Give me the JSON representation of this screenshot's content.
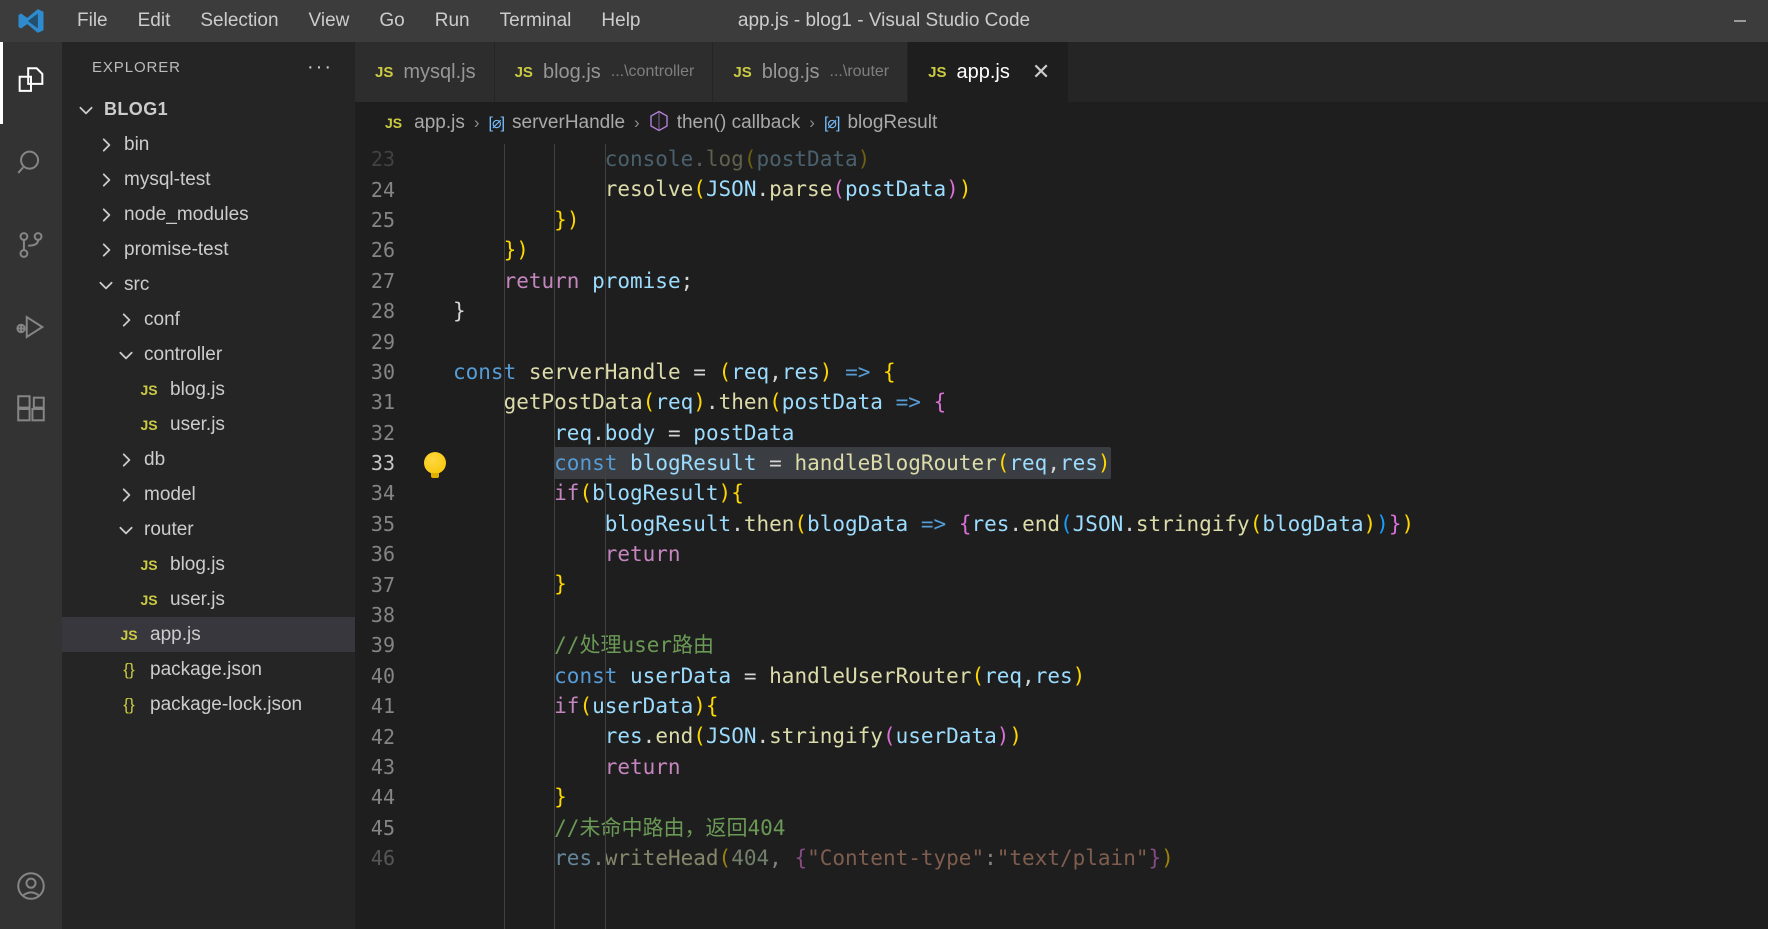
{
  "window": {
    "title": "app.js - blog1 - Visual Studio Code",
    "logo_icon": "vscode-logo-icon",
    "minimize_label": "—"
  },
  "menu": {
    "items": [
      {
        "label": "File",
        "name": "menu-file"
      },
      {
        "label": "Edit",
        "name": "menu-edit"
      },
      {
        "label": "Selection",
        "name": "menu-selection"
      },
      {
        "label": "View",
        "name": "menu-view"
      },
      {
        "label": "Go",
        "name": "menu-go"
      },
      {
        "label": "Run",
        "name": "menu-run"
      },
      {
        "label": "Terminal",
        "name": "menu-terminal"
      },
      {
        "label": "Help",
        "name": "menu-help"
      }
    ]
  },
  "activitybar": {
    "items": [
      {
        "icon": "files-explorer-icon",
        "active": true
      },
      {
        "icon": "search-icon",
        "active": false
      },
      {
        "icon": "source-control-icon",
        "active": false
      },
      {
        "icon": "run-and-debug-icon",
        "active": false
      },
      {
        "icon": "extensions-icon",
        "active": false
      }
    ],
    "bottom": {
      "icon": "accounts-icon"
    }
  },
  "sidebar": {
    "title": "EXPLORER",
    "more_actions": "···",
    "tree": [
      {
        "label": "BLOG1",
        "type": "root",
        "expanded": true,
        "indent": 0,
        "selected": false
      },
      {
        "label": "bin",
        "type": "folder",
        "expanded": false,
        "indent": 1,
        "selected": false
      },
      {
        "label": "mysql-test",
        "type": "folder",
        "expanded": false,
        "indent": 1,
        "selected": false
      },
      {
        "label": "node_modules",
        "type": "folder",
        "expanded": false,
        "indent": 1,
        "selected": false
      },
      {
        "label": "promise-test",
        "type": "folder",
        "expanded": false,
        "indent": 1,
        "selected": false
      },
      {
        "label": "src",
        "type": "folder",
        "expanded": true,
        "indent": 1,
        "selected": false
      },
      {
        "label": "conf",
        "type": "folder",
        "expanded": false,
        "indent": 2,
        "selected": false
      },
      {
        "label": "controller",
        "type": "folder",
        "expanded": true,
        "indent": 2,
        "selected": false
      },
      {
        "label": "blog.js",
        "type": "js",
        "indent": 3,
        "selected": false
      },
      {
        "label": "user.js",
        "type": "js",
        "indent": 3,
        "selected": false
      },
      {
        "label": "db",
        "type": "folder",
        "expanded": false,
        "indent": 2,
        "selected": false
      },
      {
        "label": "model",
        "type": "folder",
        "expanded": false,
        "indent": 2,
        "selected": false
      },
      {
        "label": "router",
        "type": "folder",
        "expanded": true,
        "indent": 2,
        "selected": false
      },
      {
        "label": "blog.js",
        "type": "js",
        "indent": 3,
        "selected": false
      },
      {
        "label": "user.js",
        "type": "js",
        "indent": 3,
        "selected": false
      },
      {
        "label": "app.js",
        "type": "js",
        "indent": 2,
        "selected": true
      },
      {
        "label": "package.json",
        "type": "json",
        "indent": 2,
        "selected": false
      },
      {
        "label": "package-lock.json",
        "type": "json",
        "indent": 2,
        "selected": false
      }
    ]
  },
  "tabs": [
    {
      "label": "mysql.js",
      "desc": "",
      "icon": "js-file-icon",
      "active": false,
      "closable": false
    },
    {
      "label": "blog.js",
      "desc": "...\\controller",
      "icon": "js-file-icon",
      "active": false,
      "closable": false
    },
    {
      "label": "blog.js",
      "desc": "...\\router",
      "icon": "js-file-icon",
      "active": false,
      "closable": false
    },
    {
      "label": "app.js",
      "desc": "",
      "icon": "js-file-icon",
      "active": true,
      "closable": true,
      "close_label": "✕"
    }
  ],
  "breadcrumb": {
    "separator": "›",
    "items": [
      {
        "label": "app.js",
        "icon": "js-file-icon"
      },
      {
        "label": "serverHandle",
        "icon": "symbol-variable-icon"
      },
      {
        "label": "then() callback",
        "icon": "symbol-function-icon"
      },
      {
        "label": "blogResult",
        "icon": "symbol-variable-icon"
      }
    ]
  },
  "editor": {
    "filename": "app.js",
    "first_visible_line": 23,
    "cursor_line": 33,
    "quickfix_icon": "lightbulb-icon",
    "lines": [
      {
        "num": 23,
        "partial": true,
        "tokens": [
          {
            "t": "            ",
            "c": "pun"
          },
          {
            "t": "console",
            "c": "var"
          },
          {
            "t": ".",
            "c": "pun"
          },
          {
            "t": "log",
            "c": "fn"
          },
          {
            "t": "(",
            "c": "br1"
          },
          {
            "t": "postData",
            "c": "var"
          },
          {
            "t": ")",
            "c": "br1"
          }
        ]
      },
      {
        "num": 24,
        "tokens": [
          {
            "t": "            ",
            "c": "pun"
          },
          {
            "t": "resolve",
            "c": "fn"
          },
          {
            "t": "(",
            "c": "br1"
          },
          {
            "t": "JSON",
            "c": "var"
          },
          {
            "t": ".",
            "c": "pun"
          },
          {
            "t": "parse",
            "c": "fn"
          },
          {
            "t": "(",
            "c": "br2"
          },
          {
            "t": "postData",
            "c": "var"
          },
          {
            "t": ")",
            "c": "br2"
          },
          {
            "t": ")",
            "c": "br1"
          }
        ]
      },
      {
        "num": 25,
        "tokens": [
          {
            "t": "        ",
            "c": "pun"
          },
          {
            "t": "}",
            "c": "br1"
          },
          {
            "t": ")",
            "c": "br1"
          }
        ]
      },
      {
        "num": 26,
        "tokens": [
          {
            "t": "    ",
            "c": "pun"
          },
          {
            "t": "}",
            "c": "br1"
          },
          {
            "t": ")",
            "c": "br1"
          }
        ]
      },
      {
        "num": 27,
        "tokens": [
          {
            "t": "    ",
            "c": "pun"
          },
          {
            "t": "return",
            "c": "kw2"
          },
          {
            "t": " ",
            "c": "pun"
          },
          {
            "t": "promise",
            "c": "var"
          },
          {
            "t": ";",
            "c": "pun"
          }
        ]
      },
      {
        "num": 28,
        "tokens": [
          {
            "t": "}",
            "c": "pun"
          }
        ]
      },
      {
        "num": 29,
        "tokens": []
      },
      {
        "num": 30,
        "tokens": [
          {
            "t": "const",
            "c": "kw"
          },
          {
            "t": " ",
            "c": "pun"
          },
          {
            "t": "serverHandle",
            "c": "fn"
          },
          {
            "t": " ",
            "c": "pun"
          },
          {
            "t": "=",
            "c": "pun"
          },
          {
            "t": " ",
            "c": "pun"
          },
          {
            "t": "(",
            "c": "br1"
          },
          {
            "t": "req",
            "c": "var"
          },
          {
            "t": ",",
            "c": "pun"
          },
          {
            "t": "res",
            "c": "var"
          },
          {
            "t": ")",
            "c": "br1"
          },
          {
            "t": " ",
            "c": "pun"
          },
          {
            "t": "=>",
            "c": "kw"
          },
          {
            "t": " ",
            "c": "pun"
          },
          {
            "t": "{",
            "c": "br1"
          }
        ]
      },
      {
        "num": 31,
        "tokens": [
          {
            "t": "    ",
            "c": "pun"
          },
          {
            "t": "getPostData",
            "c": "fn"
          },
          {
            "t": "(",
            "c": "br1"
          },
          {
            "t": "req",
            "c": "var"
          },
          {
            "t": ")",
            "c": "br1"
          },
          {
            "t": ".",
            "c": "pun"
          },
          {
            "t": "then",
            "c": "fn"
          },
          {
            "t": "(",
            "c": "br1"
          },
          {
            "t": "postData",
            "c": "var"
          },
          {
            "t": " ",
            "c": "pun"
          },
          {
            "t": "=>",
            "c": "kw"
          },
          {
            "t": " ",
            "c": "pun"
          },
          {
            "t": "{",
            "c": "br2"
          }
        ]
      },
      {
        "num": 32,
        "tokens": [
          {
            "t": "        ",
            "c": "pun"
          },
          {
            "t": "req",
            "c": "var"
          },
          {
            "t": ".",
            "c": "pun"
          },
          {
            "t": "body",
            "c": "var"
          },
          {
            "t": " ",
            "c": "pun"
          },
          {
            "t": "=",
            "c": "pun"
          },
          {
            "t": " ",
            "c": "pun"
          },
          {
            "t": "postData",
            "c": "var"
          }
        ]
      },
      {
        "num": 33,
        "selected": true,
        "quickfix": true,
        "sel_start_spaces": 8,
        "tokens": [
          {
            "t": "const",
            "c": "kw"
          },
          {
            "t": " ",
            "c": "mdot"
          },
          {
            "t": "blogResult",
            "c": "var"
          },
          {
            "t": " ",
            "c": "mdot"
          },
          {
            "t": "=",
            "c": "pun"
          },
          {
            "t": " ",
            "c": "mdot"
          },
          {
            "t": "handleBlogRouter",
            "c": "fn"
          },
          {
            "t": "(",
            "c": "br1"
          },
          {
            "t": "req",
            "c": "var"
          },
          {
            "t": ",",
            "c": "pun"
          },
          {
            "t": "res",
            "c": "var"
          },
          {
            "t": ")",
            "c": "br1"
          }
        ]
      },
      {
        "num": 34,
        "tokens": [
          {
            "t": "        ",
            "c": "pun"
          },
          {
            "t": "if",
            "c": "kw2"
          },
          {
            "t": "(",
            "c": "br1"
          },
          {
            "t": "blogResult",
            "c": "var"
          },
          {
            "t": ")",
            "c": "br1"
          },
          {
            "t": "{",
            "c": "br1"
          }
        ]
      },
      {
        "num": 35,
        "tokens": [
          {
            "t": "            ",
            "c": "pun"
          },
          {
            "t": "blogResult",
            "c": "var"
          },
          {
            "t": ".",
            "c": "pun"
          },
          {
            "t": "then",
            "c": "fn"
          },
          {
            "t": "(",
            "c": "br1"
          },
          {
            "t": "blogData",
            "c": "var"
          },
          {
            "t": " ",
            "c": "pun"
          },
          {
            "t": "=>",
            "c": "kw"
          },
          {
            "t": " ",
            "c": "pun"
          },
          {
            "t": "{",
            "c": "br2"
          },
          {
            "t": "res",
            "c": "var"
          },
          {
            "t": ".",
            "c": "pun"
          },
          {
            "t": "end",
            "c": "fn"
          },
          {
            "t": "(",
            "c": "br3"
          },
          {
            "t": "JSON",
            "c": "var"
          },
          {
            "t": ".",
            "c": "pun"
          },
          {
            "t": "stringify",
            "c": "fn"
          },
          {
            "t": "(",
            "c": "br1"
          },
          {
            "t": "blogData",
            "c": "var"
          },
          {
            "t": ")",
            "c": "br1"
          },
          {
            "t": ")",
            "c": "br3"
          },
          {
            "t": "}",
            "c": "br2"
          },
          {
            "t": ")",
            "c": "br1"
          }
        ]
      },
      {
        "num": 36,
        "tokens": [
          {
            "t": "            ",
            "c": "pun"
          },
          {
            "t": "return",
            "c": "kw2"
          }
        ]
      },
      {
        "num": 37,
        "tokens": [
          {
            "t": "        ",
            "c": "pun"
          },
          {
            "t": "}",
            "c": "br1"
          }
        ]
      },
      {
        "num": 38,
        "tokens": []
      },
      {
        "num": 39,
        "tokens": [
          {
            "t": "        ",
            "c": "pun"
          },
          {
            "t": "//处理user路由",
            "c": "cmt"
          }
        ]
      },
      {
        "num": 40,
        "tokens": [
          {
            "t": "        ",
            "c": "pun"
          },
          {
            "t": "const",
            "c": "kw"
          },
          {
            "t": " ",
            "c": "pun"
          },
          {
            "t": "userData",
            "c": "var"
          },
          {
            "t": " ",
            "c": "pun"
          },
          {
            "t": "=",
            "c": "pun"
          },
          {
            "t": " ",
            "c": "pun"
          },
          {
            "t": "handleUserRouter",
            "c": "fn"
          },
          {
            "t": "(",
            "c": "br1"
          },
          {
            "t": "req",
            "c": "var"
          },
          {
            "t": ",",
            "c": "pun"
          },
          {
            "t": "res",
            "c": "var"
          },
          {
            "t": ")",
            "c": "br1"
          }
        ]
      },
      {
        "num": 41,
        "tokens": [
          {
            "t": "        ",
            "c": "pun"
          },
          {
            "t": "if",
            "c": "kw2"
          },
          {
            "t": "(",
            "c": "br1"
          },
          {
            "t": "userData",
            "c": "var"
          },
          {
            "t": ")",
            "c": "br1"
          },
          {
            "t": "{",
            "c": "br1"
          }
        ]
      },
      {
        "num": 42,
        "tokens": [
          {
            "t": "            ",
            "c": "pun"
          },
          {
            "t": "res",
            "c": "var"
          },
          {
            "t": ".",
            "c": "pun"
          },
          {
            "t": "end",
            "c": "fn"
          },
          {
            "t": "(",
            "c": "br1"
          },
          {
            "t": "JSON",
            "c": "var"
          },
          {
            "t": ".",
            "c": "pun"
          },
          {
            "t": "stringify",
            "c": "fn"
          },
          {
            "t": "(",
            "c": "br2"
          },
          {
            "t": "userData",
            "c": "var"
          },
          {
            "t": ")",
            "c": "br2"
          },
          {
            "t": ")",
            "c": "br1"
          }
        ]
      },
      {
        "num": 43,
        "tokens": [
          {
            "t": "            ",
            "c": "pun"
          },
          {
            "t": "return",
            "c": "kw2"
          }
        ]
      },
      {
        "num": 44,
        "tokens": [
          {
            "t": "        ",
            "c": "pun"
          },
          {
            "t": "}",
            "c": "br1"
          }
        ]
      },
      {
        "num": 45,
        "tokens": [
          {
            "t": "        ",
            "c": "pun"
          },
          {
            "t": "//未命中路由，返回404",
            "c": "cmt"
          }
        ]
      },
      {
        "num": 46,
        "partial": true,
        "tokens": [
          {
            "t": "        ",
            "c": "pun"
          },
          {
            "t": "res",
            "c": "var"
          },
          {
            "t": ".",
            "c": "pun"
          },
          {
            "t": "writeHead",
            "c": "fn"
          },
          {
            "t": "(",
            "c": "br1"
          },
          {
            "t": "404",
            "c": "num"
          },
          {
            "t": ", ",
            "c": "pun"
          },
          {
            "t": "{",
            "c": "br2"
          },
          {
            "t": "\"Content-type\"",
            "c": "str"
          },
          {
            "t": ":",
            "c": "pun"
          },
          {
            "t": "\"text/plain\"",
            "c": "str"
          },
          {
            "t": "}",
            "c": "br2"
          },
          {
            "t": ")",
            "c": "br1"
          }
        ]
      }
    ]
  },
  "colors": {
    "titlebar_bg": "#3c3c3c",
    "activitybar_bg": "#333333",
    "sidebar_bg": "#252526",
    "editor_bg": "#1e1e1e",
    "tab_inactive_bg": "#2d2d2d",
    "selected_row_bg": "#37373d",
    "accent": "#0078d4",
    "js_icon": "#cbcb41",
    "lightbulb": "#ffcc00"
  }
}
